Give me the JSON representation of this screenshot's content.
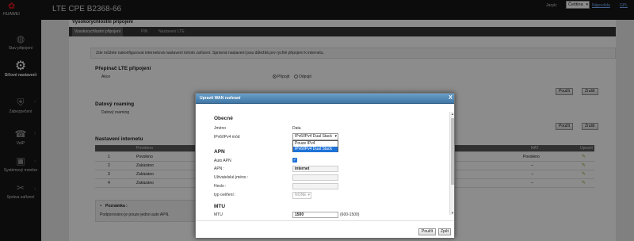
{
  "header": {
    "logo_text": "HUAWEI",
    "device_title": "LTE CPE B2368-66",
    "language_label": "Jazyk:",
    "language_value": "Čeština",
    "help_link": "Nápověda",
    "gpl_link": "GPL"
  },
  "sidebar": {
    "items": [
      {
        "label": "Stav připojení",
        "icon": "globe-icon"
      },
      {
        "label": "Síťové nastavení",
        "icon": "gears-icon",
        "active": true
      },
      {
        "label": "Zabezpečení",
        "icon": "shield-icon"
      },
      {
        "label": "VoIP",
        "icon": "phone-icon"
      },
      {
        "label": "Systémový monitor",
        "icon": "monitor-icon"
      },
      {
        "label": "Správa zařízení",
        "icon": "tools-icon"
      }
    ]
  },
  "page": {
    "heading": "Vysokorychlostní připojení",
    "tabs": [
      "Vysokorychlostní připojení",
      "PIN",
      "Nastavení LTE"
    ],
    "info_text": "Zde můžete nakonfigurovat internetová nastavení tohoto zařízení. Správná nastavení jsou důležitá pro rychlé připojení k internetu.",
    "lte_switch": {
      "title": "Přepínač LTE připojení",
      "label": "Akce",
      "options": [
        "Připojit",
        "Odpojit"
      ],
      "selected": "Připojit",
      "apply_label": "Použít",
      "cancel_label": "Zrušit"
    },
    "roaming": {
      "title": "Datový roaming",
      "label": "Datový roaming",
      "apply_label": "Použít",
      "cancel_label": "Zrušit"
    },
    "internet": {
      "title": "Nastavení internetu",
      "columns": [
        "",
        "Povoleno",
        "",
        "",
        "NAT",
        "Upravit"
      ],
      "rows": [
        {
          "id": "1",
          "status": "Povoleno",
          "nat": "Povoleno"
        },
        {
          "id": "2",
          "status": "Zakázáno",
          "nat": "--"
        },
        {
          "id": "3",
          "status": "Zakázáno",
          "nat": "--"
        },
        {
          "id": "4",
          "status": "Zakázáno",
          "nat": "--"
        }
      ]
    },
    "note": {
      "title": "Poznámka :",
      "text": "Podporováno je pouze jedno auto APN."
    }
  },
  "dialog": {
    "title": "Upravit WAN rozhraní",
    "close": "X",
    "general": {
      "title": "Obecné",
      "name_label": "Jméno",
      "name_value": "Data",
      "ip_mode_label": "IPv6/IPv4 mód",
      "ip_mode_value": "IPv6/IPv4 Dual Stack",
      "ip_mode_options": [
        "Pouze IPv4",
        "IPv6/IPv4 Dual Stack"
      ]
    },
    "apn": {
      "title": "APN",
      "auto_apn_label": "Auto APN",
      "auto_apn_checked": true,
      "apn_label": "APN :",
      "apn_value": "internet",
      "username_label": "Uživatelské jméno :",
      "username_value": "",
      "password_label": "Heslo :",
      "password_value": "",
      "auth_label": "typ ověření :",
      "auth_value": "NONE"
    },
    "mtu": {
      "title": "MTU",
      "mtu_label": "MTU",
      "mtu_value": "1500",
      "mtu_range": "(600-1500)"
    },
    "apply_label": "Použít",
    "back_label": "Zpět"
  }
}
